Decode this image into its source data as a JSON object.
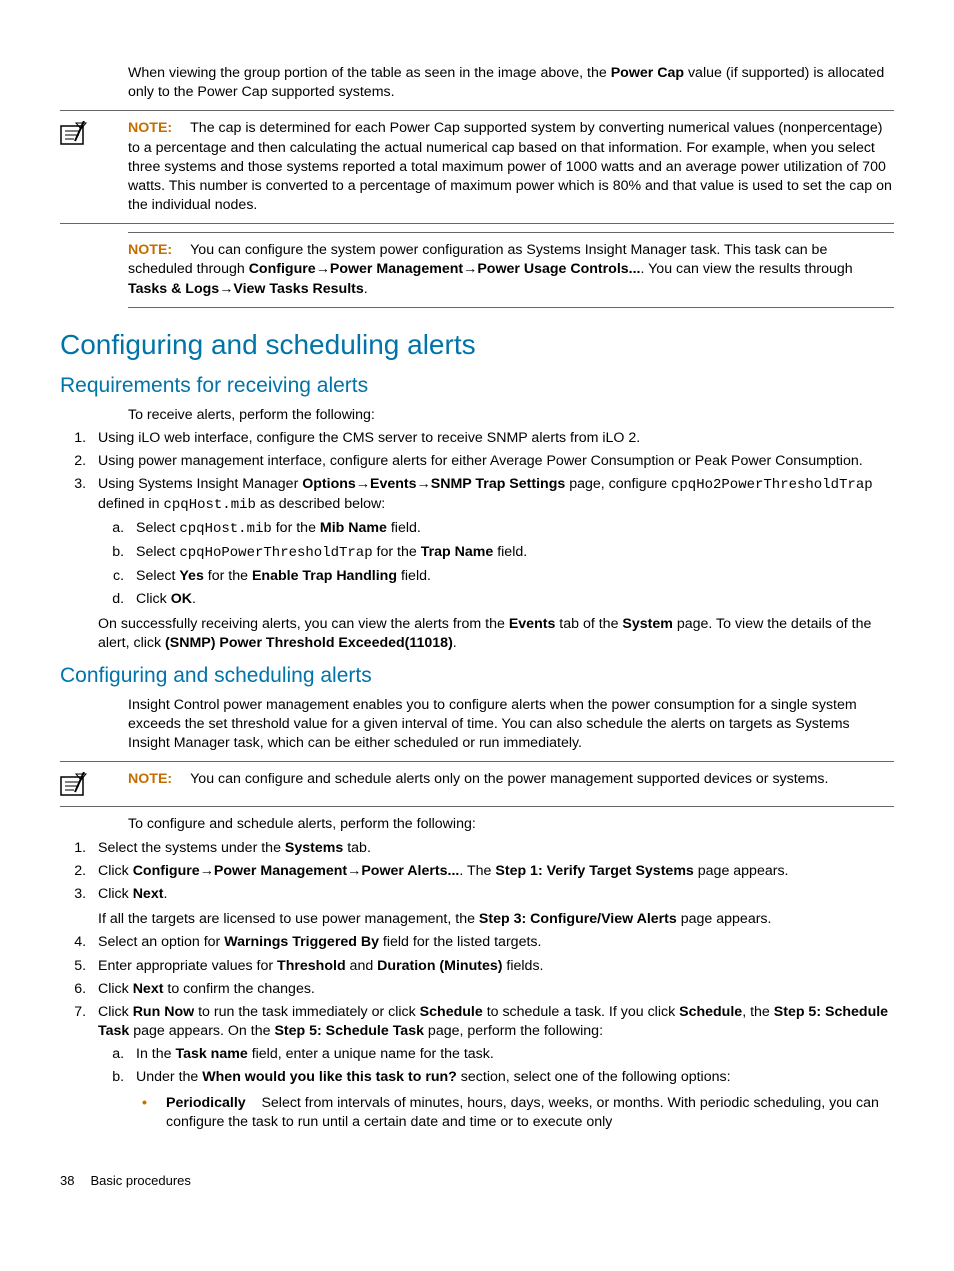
{
  "intro_para": {
    "pre": "When viewing the group portion of the table as seen in the image above, the ",
    "b1": "Power Cap",
    "post": " value (if supported) is allocated only to the Power Cap supported systems."
  },
  "note1_label": "NOTE:",
  "note1_body": "The cap is determined for each Power Cap supported system by converting numerical values (nonpercentage) to a percentage and then calculating the actual numerical cap based on that information. For example, when you select three systems and those systems reported a total maximum power of 1000 watts and an average power utilization of 700 watts. This number is converted to a percentage of maximum power which is 80% and that value is used to set the cap on the individual nodes.",
  "note2_label": "NOTE:",
  "note2": {
    "t1": "You can configure the system power configuration as Systems Insight Manager task. This task can be scheduled through ",
    "b1": "Configure",
    "b2": "Power Management",
    "b3": "Power Usage Controls...",
    "t2": ". You can view the results through ",
    "b4": "Tasks & Logs",
    "b5": "View Tasks Results",
    "t3": "."
  },
  "h1a": "Configuring and scheduling alerts",
  "h2a": "Requirements for receiving alerts",
  "req_intro": "To receive alerts, perform the following:",
  "req1": "Using iLO web interface, configure the CMS server to receive SNMP alerts from iLO 2.",
  "req2": "Using power management interface, configure alerts for either Average Power Consumption or Peak Power Consumption.",
  "req3": {
    "t1": "Using Systems Insight Manager ",
    "b1": "Options",
    "b2": "Events",
    "b3": "SNMP Trap Settings",
    "t2": " page, configure ",
    "m1": "cpqHo2PowerThresholdTrap",
    "t3": " defined in ",
    "m2": "cpqHost.mib",
    "t4": " as described below:"
  },
  "req3a": {
    "t1": "Select ",
    "m1": "cpqHost.mib",
    "t2": " for the ",
    "b1": "Mib Name",
    "t3": " field."
  },
  "req3b": {
    "t1": "Select ",
    "m1": "cpqHoPowerThresholdTrap",
    "t2": " for the ",
    "b1": "Trap Name",
    "t3": " field."
  },
  "req3c": {
    "t1": "Select ",
    "b1": "Yes",
    "t2": " for the ",
    "b2": "Enable Trap Handling",
    "t3": " field."
  },
  "req3d": {
    "t1": "Click ",
    "b1": "OK",
    "t2": "."
  },
  "req_after": {
    "t1": "On successfully receiving alerts, you can view the alerts from the ",
    "b1": "Events",
    "t2": " tab of the ",
    "b2": "System",
    "t3": " page. To view the details of the alert, click ",
    "b3": "(SNMP) Power Threshold Exceeded(11018)",
    "t4": "."
  },
  "h2b": "Configuring and scheduling alerts",
  "cfg_intro": "Insight Control power management enables you to configure alerts when the power consumption for a single system exceeds the set threshold value for a given interval of time. You can also schedule the alerts on targets as Systems Insight Manager task, which can be either scheduled or run immediately.",
  "note3_label": "NOTE:",
  "note3_body": "You can configure and schedule alerts only on the power management supported devices or systems.",
  "steps_intro": "To configure and schedule alerts, perform the following:",
  "s1": {
    "t1": "Select the systems under the ",
    "b1": "Systems",
    "t2": " tab."
  },
  "s2": {
    "t1": "Click ",
    "b1": "Configure",
    "b2": "Power Management",
    "b3": "Power Alerts...",
    "t2": ". The ",
    "b4": "Step 1: Verify Target Systems",
    "t3": " page appears."
  },
  "s3": {
    "t1": "Click ",
    "b1": "Next",
    "t2": "."
  },
  "s3_after": {
    "t1": "If all the targets are licensed to use power management, the ",
    "b1": "Step 3: Configure/View Alerts",
    "t2": " page appears."
  },
  "s4": {
    "t1": "Select an option for ",
    "b1": "Warnings Triggered By",
    "t2": " field for the listed targets."
  },
  "s5": {
    "t1": "Enter appropriate values for ",
    "b1": "Threshold",
    "t2": " and ",
    "b2": "Duration (Minutes)",
    "t3": " fields."
  },
  "s6": {
    "t1": "Click ",
    "b1": "Next",
    "t2": " to confirm the changes."
  },
  "s7": {
    "t1": "Click ",
    "b1": "Run Now",
    "t2": " to run the task immediately or click ",
    "b2": "Schedule",
    "t3": " to schedule a task. If you click ",
    "b3": "Schedule",
    "t4": ", the ",
    "b4": "Step 5: Schedule Task",
    "t5": " page appears. On the ",
    "b5": "Step 5: Schedule Task",
    "t6": " page, perform the following:"
  },
  "s7a": {
    "t1": "In the ",
    "b1": "Task name",
    "t2": " field, enter a unique name for the task."
  },
  "s7b": {
    "t1": "Under the ",
    "b1": "When would you like this task to run?",
    "t2": " section, select one of the following options:"
  },
  "s7b1_label": "Periodically",
  "s7b1_text": "Select from intervals of minutes, hours, days, weeks, or months. With periodic scheduling, you can configure the task to run until a certain date and time or to execute only",
  "footer_page": "38",
  "footer_text": "Basic procedures"
}
